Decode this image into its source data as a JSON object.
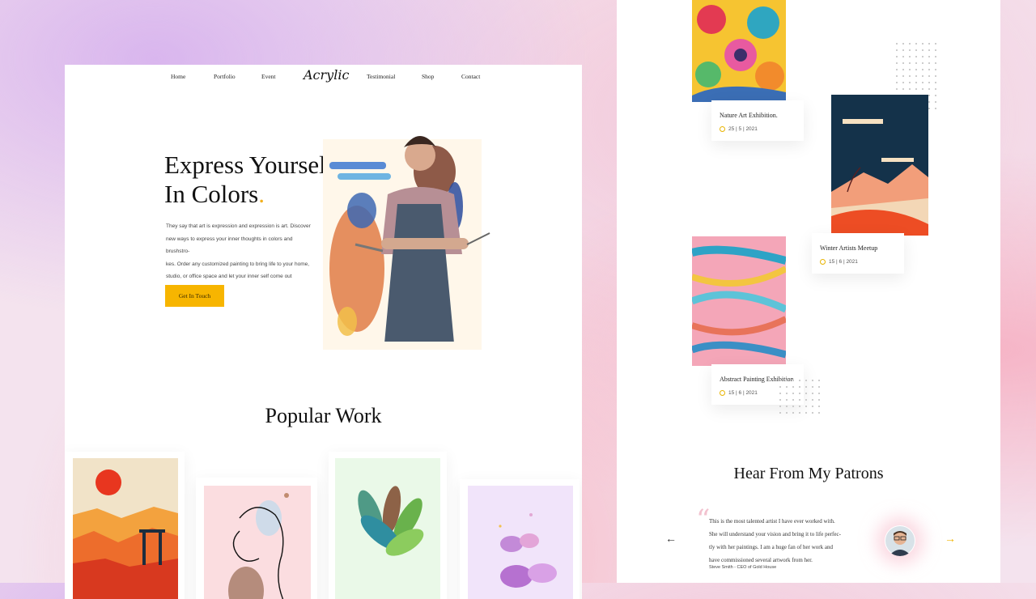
{
  "nav": {
    "items": [
      "Home",
      "Portfolio",
      "Event",
      "Testimonial",
      "Shop",
      "Contact"
    ],
    "logo": "Acrylic"
  },
  "hero": {
    "title_line1": "Express Yourself",
    "title_line2": "In Colors",
    "title_dot": ".",
    "description_lines": [
      "They say that art is expression and expression is art. Discover",
      "new ways to express your inner thoughts in colors and brushstro-",
      "kes. Order any customized painting to bring life to your home,",
      "studio, or office space and let your inner self come out",
      "in shades and hues."
    ],
    "cta_label": "Get In Touch"
  },
  "popular": {
    "title": "Popular Work"
  },
  "events": [
    {
      "title": "Nature Art Exhibition.",
      "date": "25 | 5 | 2021"
    },
    {
      "title": "Winter Artists Meetup",
      "date": "15 | 6 | 2021"
    },
    {
      "title": "Abstract Painting Exhibition",
      "date": "15 | 6 | 2021"
    }
  ],
  "patrons": {
    "title": "Hear From My Patrons",
    "quote_lines": [
      "This is the most talented artist I have ever worked with.",
      "She will understand your vision and bring it to life perfec-",
      "tly with her paintings. I am a huge fan of her work and",
      "have commissioned several artwork from her."
    ],
    "author": "Steve Smith - CEO of Gold House",
    "prev_icon": "←",
    "next_icon": "→"
  },
  "colors": {
    "accent": "#f7b500",
    "accent_dark": "#f2b01e",
    "text": "#111111"
  }
}
